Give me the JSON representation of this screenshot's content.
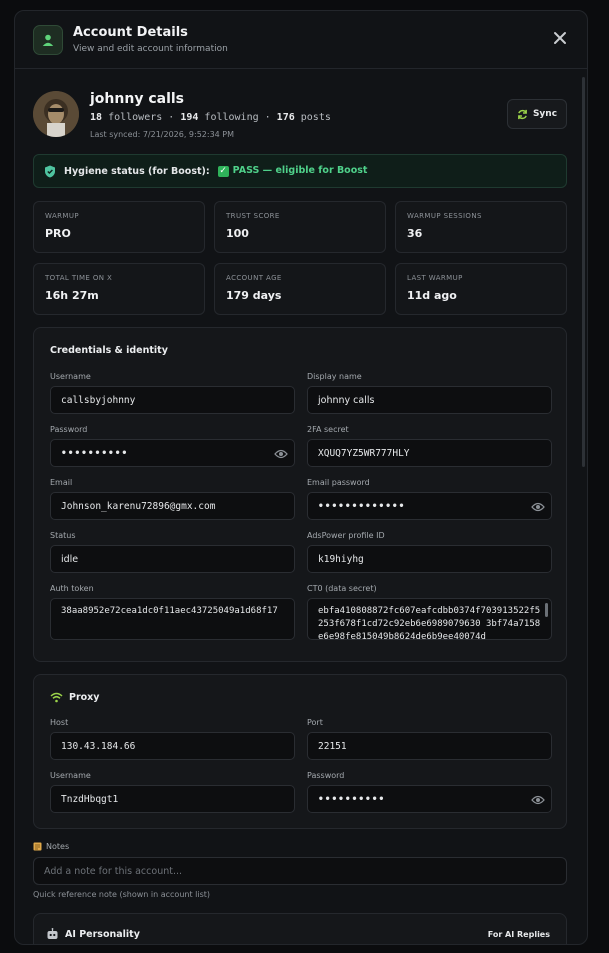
{
  "header": {
    "title": "Account Details",
    "subtitle": "View and edit account information"
  },
  "profile": {
    "name": "johnny calls",
    "followers_count": "18",
    "followers_label": "followers",
    "following_count": "194",
    "following_label": "following",
    "posts_count": "176",
    "posts_label": "posts",
    "last_synced": "Last synced: 7/21/2026, 9:52:34 PM",
    "sync_label": "Sync"
  },
  "hygiene": {
    "label": "Hygiene status (for Boost):",
    "value": "PASS — eligible for Boost"
  },
  "stats": [
    {
      "label": "WARMUP",
      "value": "PRO"
    },
    {
      "label": "TRUST SCORE",
      "value": "100"
    },
    {
      "label": "WARMUP SESSIONS",
      "value": "36"
    },
    {
      "label": "TOTAL TIME ON X",
      "value": "16h 27m"
    },
    {
      "label": "ACCOUNT AGE",
      "value": "179 days"
    },
    {
      "label": "LAST WARMUP",
      "value": "11d ago"
    }
  ],
  "credentials": {
    "title": "Credentials & identity",
    "username_label": "Username",
    "username": "callsbyjohnny",
    "display_name_label": "Display name",
    "display_name": "johnny calls",
    "password_label": "Password",
    "password": "••••••••••",
    "twofa_label": "2FA secret",
    "twofa": "XQUQ7YZ5WR777HLY",
    "email_label": "Email",
    "email": "Johnson_karenu72896@gmx.com",
    "email_password_label": "Email password",
    "email_password": "•••••••••••••",
    "status_label": "Status",
    "status": "idle",
    "adspower_label": "AdsPower profile ID",
    "adspower": "k19hiyhg",
    "auth_token_label": "Auth token",
    "auth_token": "38aa8952e72cea1dc0f11aec43725049a1d68f17",
    "ct0_label": "CT0 (data secret)",
    "ct0": "ebfa410808872fc607eafcdbb0374f703913522f5253f678f1cd72c92eb6e6989079630 3bf74a7158e6e98fe815049b8624de6b9ee40074d"
  },
  "proxy": {
    "title": "Proxy",
    "host_label": "Host",
    "host": "130.43.184.66",
    "port_label": "Port",
    "port": "22151",
    "username_label": "Username",
    "username": "TnzdHbqgt1",
    "password_label": "Password",
    "password": "••••••••••"
  },
  "notes": {
    "label": "Notes",
    "placeholder": "Add a note for this account...",
    "help": "Quick reference note (shown in account list)"
  },
  "ai": {
    "title": "AI Personality",
    "right_label": "For AI Replies"
  },
  "colors": {
    "accent_green": "#4fd18a",
    "sync_icon": "#9bd34a",
    "wifi_icon": "#9bd34a"
  }
}
